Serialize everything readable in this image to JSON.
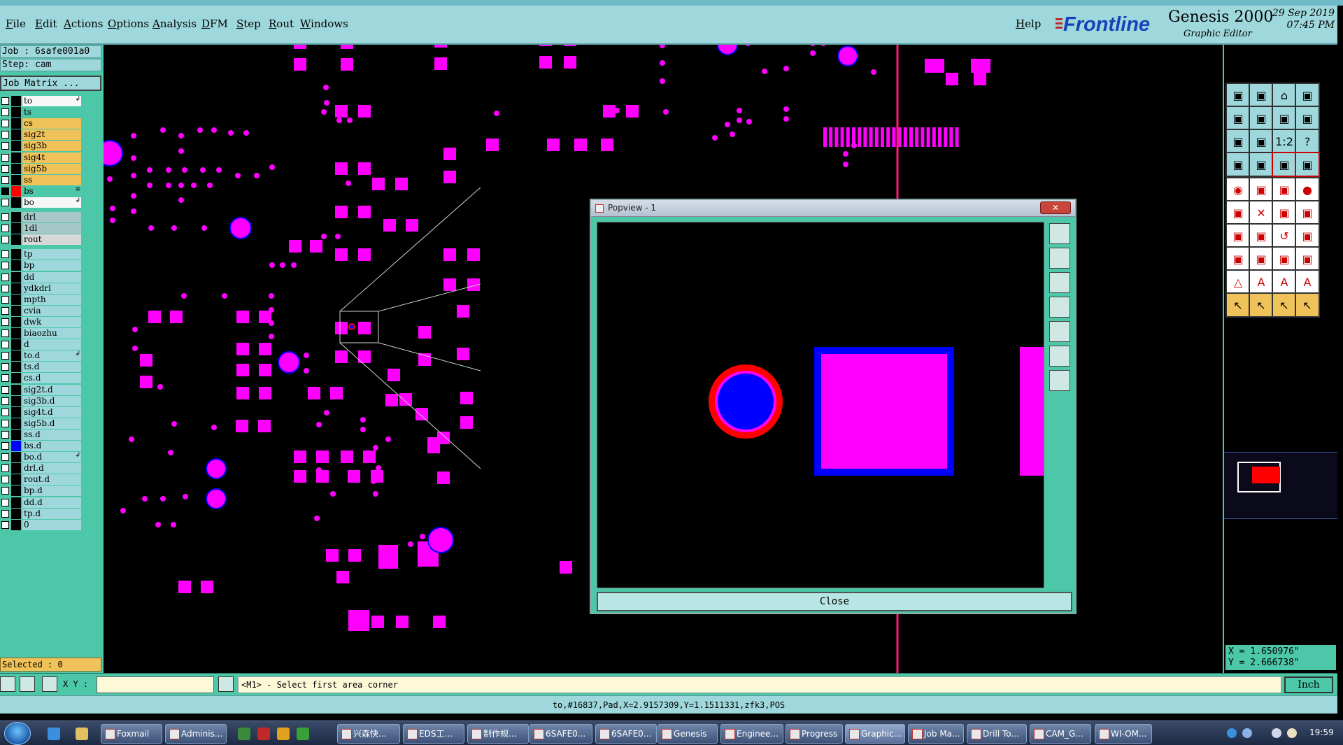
{
  "menu": {
    "items": [
      "File",
      "Edit",
      "Actions",
      "Options",
      "Analysis",
      "DFM",
      "Step",
      "Rout",
      "Windows"
    ],
    "help": "Help"
  },
  "brand": {
    "logo": "Frontline",
    "product": "Genesis 2000",
    "subtitle": "Graphic Editor",
    "date": "29 Sep 2019",
    "time": "07:45 PM"
  },
  "left": {
    "job": "Job : 6safe001a0",
    "step": "Step: cam",
    "job_matrix": "Job Matrix ...",
    "selected": "Selected : 0"
  },
  "layers": [
    {
      "name": "to",
      "color": "#f7f7f7",
      "swatch": "#000000",
      "mark": "↲"
    },
    {
      "name": "ts",
      "color": "#4cc7a8",
      "swatch": "#000000"
    },
    {
      "name": "cs",
      "color": "#f0c25a",
      "swatch": "#000000"
    },
    {
      "name": "sig2t",
      "color": "#f0c25a",
      "swatch": "#000000"
    },
    {
      "name": "sig3b",
      "color": "#f0c25a",
      "swatch": "#000000"
    },
    {
      "name": "sig4t",
      "color": "#f0c25a",
      "swatch": "#000000"
    },
    {
      "name": "sig5b",
      "color": "#f0c25a",
      "swatch": "#000000"
    },
    {
      "name": "ss",
      "color": "#f0c25a",
      "swatch": "#000000"
    },
    {
      "name": "bs",
      "color": "#4cc7a8",
      "swatch": "#ff0000",
      "mark": "≡"
    },
    {
      "name": "bo",
      "color": "#f7f7f7",
      "swatch": "#000000",
      "mark": "↲"
    },
    {
      "name": "drl",
      "color": "#a8c8c8",
      "swatch": "#000000"
    },
    {
      "name": "1dl",
      "color": "#a8c8c8",
      "swatch": "#000000"
    },
    {
      "name": "rout",
      "color": "#d8d8d8",
      "swatch": "#000000"
    },
    {
      "name": "tp",
      "color": "#9ed8dc",
      "swatch": "#000000"
    },
    {
      "name": "bp",
      "color": "#9ed8dc",
      "swatch": "#000000"
    },
    {
      "name": "dd",
      "color": "#9ed8dc",
      "swatch": "#000000"
    },
    {
      "name": "ydkdrl",
      "color": "#9ed8dc",
      "swatch": "#000000"
    },
    {
      "name": "mpth",
      "color": "#9ed8dc",
      "swatch": "#000000"
    },
    {
      "name": "cvia",
      "color": "#9ed8dc",
      "swatch": "#000000"
    },
    {
      "name": "dwk",
      "color": "#9ed8dc",
      "swatch": "#000000"
    },
    {
      "name": "biaozhu",
      "color": "#9ed8dc",
      "swatch": "#000000"
    },
    {
      "name": "d",
      "color": "#9ed8dc",
      "swatch": "#000000"
    },
    {
      "name": "to.d",
      "color": "#9ed8dc",
      "swatch": "#000000",
      "mark": "↲"
    },
    {
      "name": "ts.d",
      "color": "#9ed8dc",
      "swatch": "#000000"
    },
    {
      "name": "cs.d",
      "color": "#9ed8dc",
      "swatch": "#000000"
    },
    {
      "name": "sig2t.d",
      "color": "#9ed8dc",
      "swatch": "#000000"
    },
    {
      "name": "sig3b.d",
      "color": "#9ed8dc",
      "swatch": "#000000"
    },
    {
      "name": "sig4t.d",
      "color": "#9ed8dc",
      "swatch": "#000000"
    },
    {
      "name": "sig5b.d",
      "color": "#9ed8dc",
      "swatch": "#000000"
    },
    {
      "name": "ss.d",
      "color": "#9ed8dc",
      "swatch": "#000000"
    },
    {
      "name": "bs.d",
      "color": "#9ed8dc",
      "swatch": "#0000ff"
    },
    {
      "name": "bo.d",
      "color": "#9ed8dc",
      "swatch": "#000000",
      "mark": "↲"
    },
    {
      "name": "drl.d",
      "color": "#9ed8dc",
      "swatch": "#000000"
    },
    {
      "name": "rout.d",
      "color": "#9ed8dc",
      "swatch": "#000000"
    },
    {
      "name": "bp.d",
      "color": "#9ed8dc",
      "swatch": "#000000"
    },
    {
      "name": "dd.d",
      "color": "#9ed8dc",
      "swatch": "#000000"
    },
    {
      "name": "tp.d",
      "color": "#9ed8dc",
      "swatch": "#000000"
    },
    {
      "name": "0",
      "color": "#9ed8dc",
      "swatch": "#000000"
    }
  ],
  "popview": {
    "title": "Popview - 1",
    "close_x": "✕",
    "close_label": "Close"
  },
  "coords": {
    "x": "X = 1.650976\"",
    "y": "Y = 2.666738\""
  },
  "command": {
    "xy_label": "X Y :",
    "xy_value": "",
    "prompt": "<M1> - Select first area corner",
    "units": "Inch"
  },
  "status": "to,#16837,Pad,X=2.9157309,Y=1.1511331,zfk3,POS",
  "taskbar": {
    "tasks": [
      "Foxmail",
      "Adminis...",
      "兴森快...",
      "EDS工...",
      "制作规...",
      "6SAFE0...",
      "6SAFE0...",
      "Genesis",
      "Enginee...",
      "Progress",
      "Graphic...",
      "Job Ma...",
      "Drill To...",
      "CAM_G...",
      "WI-OM..."
    ],
    "active_task": "Graphic...",
    "clock": "19:59"
  },
  "colors": {
    "pad": "#ff00ff",
    "highlight": "#ff0000",
    "selected_layer": "#0000ff",
    "panel": "#4cc7a8",
    "menu": "#9ed8dc"
  },
  "icons": [
    "move-icon",
    "pan-icon",
    "home-icon",
    "window-icon",
    "zoom-in-icon",
    "zoom-out-icon",
    "ratio-icon",
    "help-icon",
    "select-icon",
    "pointer-icon"
  ]
}
